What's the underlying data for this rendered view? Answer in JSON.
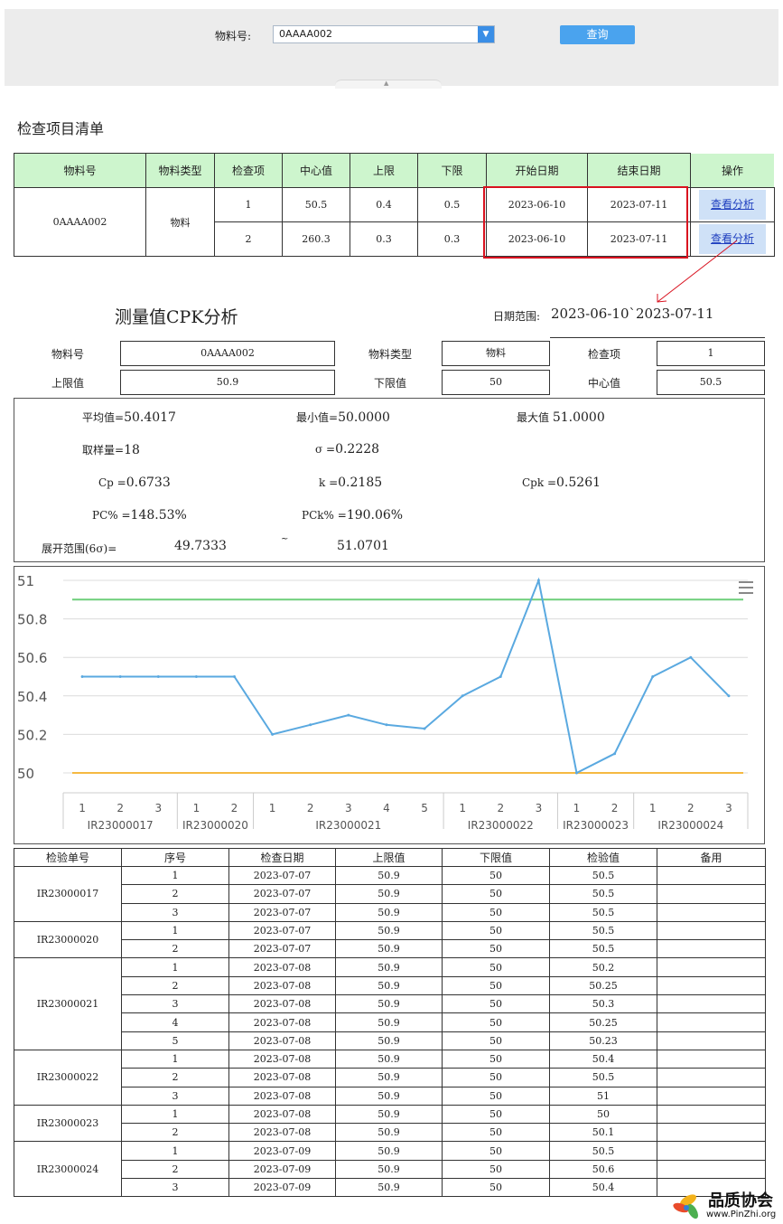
{
  "query": {
    "material_label": "物料号:",
    "material_value": "0AAAA002",
    "query_button": "查询"
  },
  "inspection": {
    "title": "检查项目清单",
    "headers": [
      "物料号",
      "物料类型",
      "检查项",
      "中心值",
      "上限",
      "下限",
      "开始日期",
      "结束日期",
      "操作"
    ],
    "material": "0AAAA002",
    "material_type": "物料",
    "rows": [
      {
        "item": "1",
        "center": "50.5",
        "upper": "0.4",
        "lower": "0.5",
        "start": "2023-06-10",
        "end": "2023-07-11",
        "action": "查看分析"
      },
      {
        "item": "2",
        "center": "260.3",
        "upper": "0.3",
        "lower": "0.3",
        "start": "2023-06-10",
        "end": "2023-07-11",
        "action": "查看分析"
      }
    ]
  },
  "cpk": {
    "title": "测量值CPK分析",
    "date_range_label": "日期范围:",
    "date_range_value": "2023-06-10`2023-07-11",
    "fields": {
      "material_label": "物料号",
      "material_value": "0AAAA002",
      "type_label": "物料类型",
      "type_value": "物料",
      "item_label": "检查项",
      "item_value": "1",
      "usl_label": "上限值",
      "usl_value": "50.9",
      "lsl_label": "下限值",
      "lsl_value": "50",
      "center_label": "中心值",
      "center_value": "50.5"
    },
    "stats": {
      "mean_label": "平均值=",
      "mean": "50.4017",
      "min_label": "最小值=",
      "min": "50.0000",
      "max_label": "最大值",
      "max": "51.0000",
      "n_label": "取样量=",
      "n": "18",
      "sigma_label": "σ =",
      "sigma": "0.2228",
      "cp_label": "Cp =",
      "cp": "0.6733",
      "k_label": "k =",
      "k": "0.2185",
      "cpk_label": "Cpk =",
      "cpk": "0.5261",
      "pc_label": "PC% =",
      "pc": "148.53%",
      "pck_label": "PCk% =",
      "pck": "190.06%",
      "spread_label": "展开范围(6σ)=",
      "spread_low": "49.7333",
      "spread_sep": "~",
      "spread_high": "51.0701"
    }
  },
  "chart_data": {
    "type": "line",
    "ylim": [
      50,
      51
    ],
    "yticks": [
      "51",
      "50.8",
      "50.6",
      "50.4",
      "50.2",
      "50"
    ],
    "groups": [
      {
        "name": "IR23000017",
        "seq": [
          "1",
          "2",
          "3"
        ]
      },
      {
        "name": "IR23000020",
        "seq": [
          "1",
          "2"
        ]
      },
      {
        "name": "IR23000021",
        "seq": [
          "1",
          "2",
          "3",
          "4",
          "5"
        ]
      },
      {
        "name": "IR23000022",
        "seq": [
          "1",
          "2",
          "3"
        ]
      },
      {
        "name": "IR23000023",
        "seq": [
          "1",
          "2"
        ]
      },
      {
        "name": "IR23000024",
        "seq": [
          "1",
          "2",
          "3"
        ]
      }
    ],
    "values": [
      50.5,
      50.5,
      50.5,
      50.5,
      50.5,
      50.2,
      50.25,
      50.3,
      50.25,
      50.23,
      50.4,
      50.5,
      51,
      50,
      50.1,
      50.5,
      50.6,
      50.4
    ],
    "usl": 50.9,
    "lsl": 50,
    "colors": {
      "series": "#5aa9e0",
      "usl": "#6dce7a",
      "lsl": "#f5b942"
    }
  },
  "detail": {
    "headers": [
      "检验单号",
      "序号",
      "检查日期",
      "上限值",
      "下限值",
      "检验值",
      "备用"
    ],
    "groups": [
      {
        "id": "IR23000017",
        "rows": [
          {
            "seq": "1",
            "date": "2023-07-07",
            "upper": "50.9",
            "lower": "50",
            "value": "50.5"
          },
          {
            "seq": "2",
            "date": "2023-07-07",
            "upper": "50.9",
            "lower": "50",
            "value": "50.5"
          },
          {
            "seq": "3",
            "date": "2023-07-07",
            "upper": "50.9",
            "lower": "50",
            "value": "50.5"
          }
        ]
      },
      {
        "id": "IR23000020",
        "rows": [
          {
            "seq": "1",
            "date": "2023-07-07",
            "upper": "50.9",
            "lower": "50",
            "value": "50.5"
          },
          {
            "seq": "2",
            "date": "2023-07-07",
            "upper": "50.9",
            "lower": "50",
            "value": "50.5"
          }
        ]
      },
      {
        "id": "IR23000021",
        "rows": [
          {
            "seq": "1",
            "date": "2023-07-08",
            "upper": "50.9",
            "lower": "50",
            "value": "50.2"
          },
          {
            "seq": "2",
            "date": "2023-07-08",
            "upper": "50.9",
            "lower": "50",
            "value": "50.25"
          },
          {
            "seq": "3",
            "date": "2023-07-08",
            "upper": "50.9",
            "lower": "50",
            "value": "50.3"
          },
          {
            "seq": "4",
            "date": "2023-07-08",
            "upper": "50.9",
            "lower": "50",
            "value": "50.25"
          },
          {
            "seq": "5",
            "date": "2023-07-08",
            "upper": "50.9",
            "lower": "50",
            "value": "50.23"
          }
        ]
      },
      {
        "id": "IR23000022",
        "rows": [
          {
            "seq": "1",
            "date": "2023-07-08",
            "upper": "50.9",
            "lower": "50",
            "value": "50.4"
          },
          {
            "seq": "2",
            "date": "2023-07-08",
            "upper": "50.9",
            "lower": "50",
            "value": "50.5"
          },
          {
            "seq": "3",
            "date": "2023-07-08",
            "upper": "50.9",
            "lower": "50",
            "value": "51"
          }
        ]
      },
      {
        "id": "IR23000023",
        "rows": [
          {
            "seq": "1",
            "date": "2023-07-08",
            "upper": "50.9",
            "lower": "50",
            "value": "50"
          },
          {
            "seq": "2",
            "date": "2023-07-08",
            "upper": "50.9",
            "lower": "50",
            "value": "50.1"
          }
        ]
      },
      {
        "id": "IR23000024",
        "rows": [
          {
            "seq": "1",
            "date": "2023-07-09",
            "upper": "50.9",
            "lower": "50",
            "value": "50.5"
          },
          {
            "seq": "2",
            "date": "2023-07-09",
            "upper": "50.9",
            "lower": "50",
            "value": "50.6"
          },
          {
            "seq": "3",
            "date": "2023-07-09",
            "upper": "50.9",
            "lower": "50",
            "value": "50.4"
          }
        ]
      }
    ]
  },
  "watermark": {
    "title": "品质协会",
    "url": "www.PinZhi.org"
  }
}
